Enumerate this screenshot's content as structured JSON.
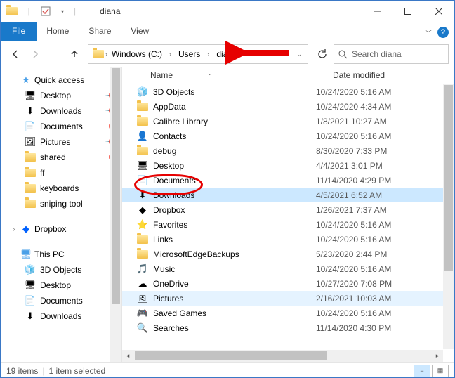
{
  "title": "diana",
  "tabs": {
    "file": "File",
    "home": "Home",
    "share": "Share",
    "view": "View"
  },
  "breadcrumb": [
    "Windows (C:)",
    "Users",
    "diana"
  ],
  "search_placeholder": "Search diana",
  "columns": {
    "name": "Name",
    "date": "Date modified"
  },
  "nav": {
    "quick": {
      "label": "Quick access",
      "items": [
        {
          "label": "Desktop",
          "pin": true,
          "icon": "desktop"
        },
        {
          "label": "Downloads",
          "pin": true,
          "icon": "downloads"
        },
        {
          "label": "Documents",
          "pin": true,
          "icon": "documents"
        },
        {
          "label": "Pictures",
          "pin": true,
          "icon": "pictures"
        },
        {
          "label": "shared",
          "pin": true,
          "icon": "folder"
        },
        {
          "label": "ff",
          "pin": false,
          "icon": "folder"
        },
        {
          "label": "keyboards",
          "pin": false,
          "icon": "folder"
        },
        {
          "label": "sniping tool",
          "pin": false,
          "icon": "folder"
        }
      ]
    },
    "dropbox": {
      "label": "Dropbox"
    },
    "thispc": {
      "label": "This PC",
      "items": [
        {
          "label": "3D Objects",
          "icon": "3d"
        },
        {
          "label": "Desktop",
          "icon": "desktop"
        },
        {
          "label": "Documents",
          "icon": "documents"
        },
        {
          "label": "Downloads",
          "icon": "downloads"
        }
      ]
    }
  },
  "files": [
    {
      "name": "3D Objects",
      "date": "10/24/2020 5:16 AM",
      "icon": "3d"
    },
    {
      "name": "AppData",
      "date": "10/24/2020 4:34 AM",
      "icon": "folder"
    },
    {
      "name": "Calibre Library",
      "date": "1/8/2021 10:27 AM",
      "icon": "folder"
    },
    {
      "name": "Contacts",
      "date": "10/24/2020 5:16 AM",
      "icon": "contacts"
    },
    {
      "name": "debug",
      "date": "8/30/2020 7:33 PM",
      "icon": "folder"
    },
    {
      "name": "Desktop",
      "date": "4/4/2021 3:01 PM",
      "icon": "desktop"
    },
    {
      "name": "Documents",
      "date": "11/14/2020 4:29 PM",
      "icon": "documents"
    },
    {
      "name": "Downloads",
      "date": "4/5/2021 6:52 AM",
      "icon": "downloads",
      "selected": true
    },
    {
      "name": "Dropbox",
      "date": "1/26/2021 7:37 AM",
      "icon": "dropbox"
    },
    {
      "name": "Favorites",
      "date": "10/24/2020 5:16 AM",
      "icon": "favorites"
    },
    {
      "name": "Links",
      "date": "10/24/2020 5:16 AM",
      "icon": "folder"
    },
    {
      "name": "MicrosoftEdgeBackups",
      "date": "5/23/2020 2:44 PM",
      "icon": "folder"
    },
    {
      "name": "Music",
      "date": "10/24/2020 5:16 AM",
      "icon": "music"
    },
    {
      "name": "OneDrive",
      "date": "10/27/2020 7:08 PM",
      "icon": "onedrive"
    },
    {
      "name": "Pictures",
      "date": "2/16/2021 10:03 AM",
      "icon": "pictures",
      "cut": true
    },
    {
      "name": "Saved Games",
      "date": "10/24/2020 5:16 AM",
      "icon": "games"
    },
    {
      "name": "Searches",
      "date": "11/14/2020 4:30 PM",
      "icon": "search"
    }
  ],
  "status": {
    "count": "19 items",
    "selected": "1 item selected"
  }
}
